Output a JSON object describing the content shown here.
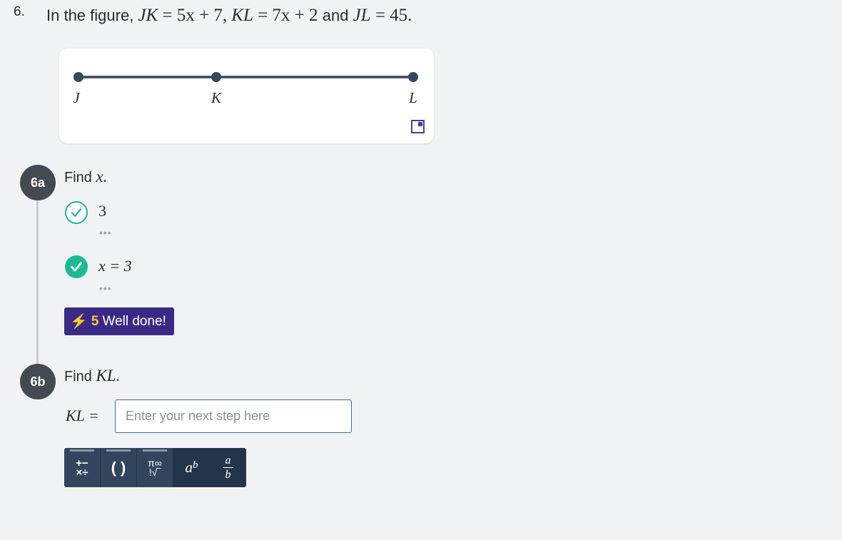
{
  "question": {
    "number": "6.",
    "intro": "In the figure,",
    "jk_lhs": "JK",
    "jk_rhs": "= 5x + 7,",
    "kl_lhs": "KL",
    "kl_rhs": "= 7x + 2",
    "and": "and",
    "jl_lhs": "JL",
    "jl_rhs": "= 45."
  },
  "figure": {
    "points": [
      "J",
      "K",
      "L"
    ]
  },
  "part_a": {
    "badge": "6a",
    "prompt": "Find",
    "variable": "x.",
    "steps": [
      {
        "value": "3",
        "more": "•••"
      },
      {
        "value": "x = 3",
        "more": "•••"
      }
    ],
    "feedback": {
      "bolt": "⚡",
      "points": "5",
      "message": "Well done!"
    }
  },
  "part_b": {
    "badge": "6b",
    "prompt": "Find",
    "variable": "KL.",
    "input_label": "KL  =",
    "input_placeholder": "Enter your next step here",
    "input_value": ""
  },
  "toolbar": {
    "ops_top": "+−",
    "ops_bottom": "×÷",
    "parens": "( )",
    "pi_top": "π∞",
    "pi_bottom": "!√‾",
    "exp_base": "a",
    "exp_power": "b",
    "frac_num": "a",
    "frac_den": "b"
  },
  "colors": {
    "background": "#f1f2f4",
    "line": "#34495e",
    "success": "#1fb894",
    "badge": "#444a52",
    "feedback_bg": "#3a2a85",
    "feedback_points": "#f6c64b",
    "toolbar_bg": "#24344a",
    "input_border": "#3b6e96"
  }
}
